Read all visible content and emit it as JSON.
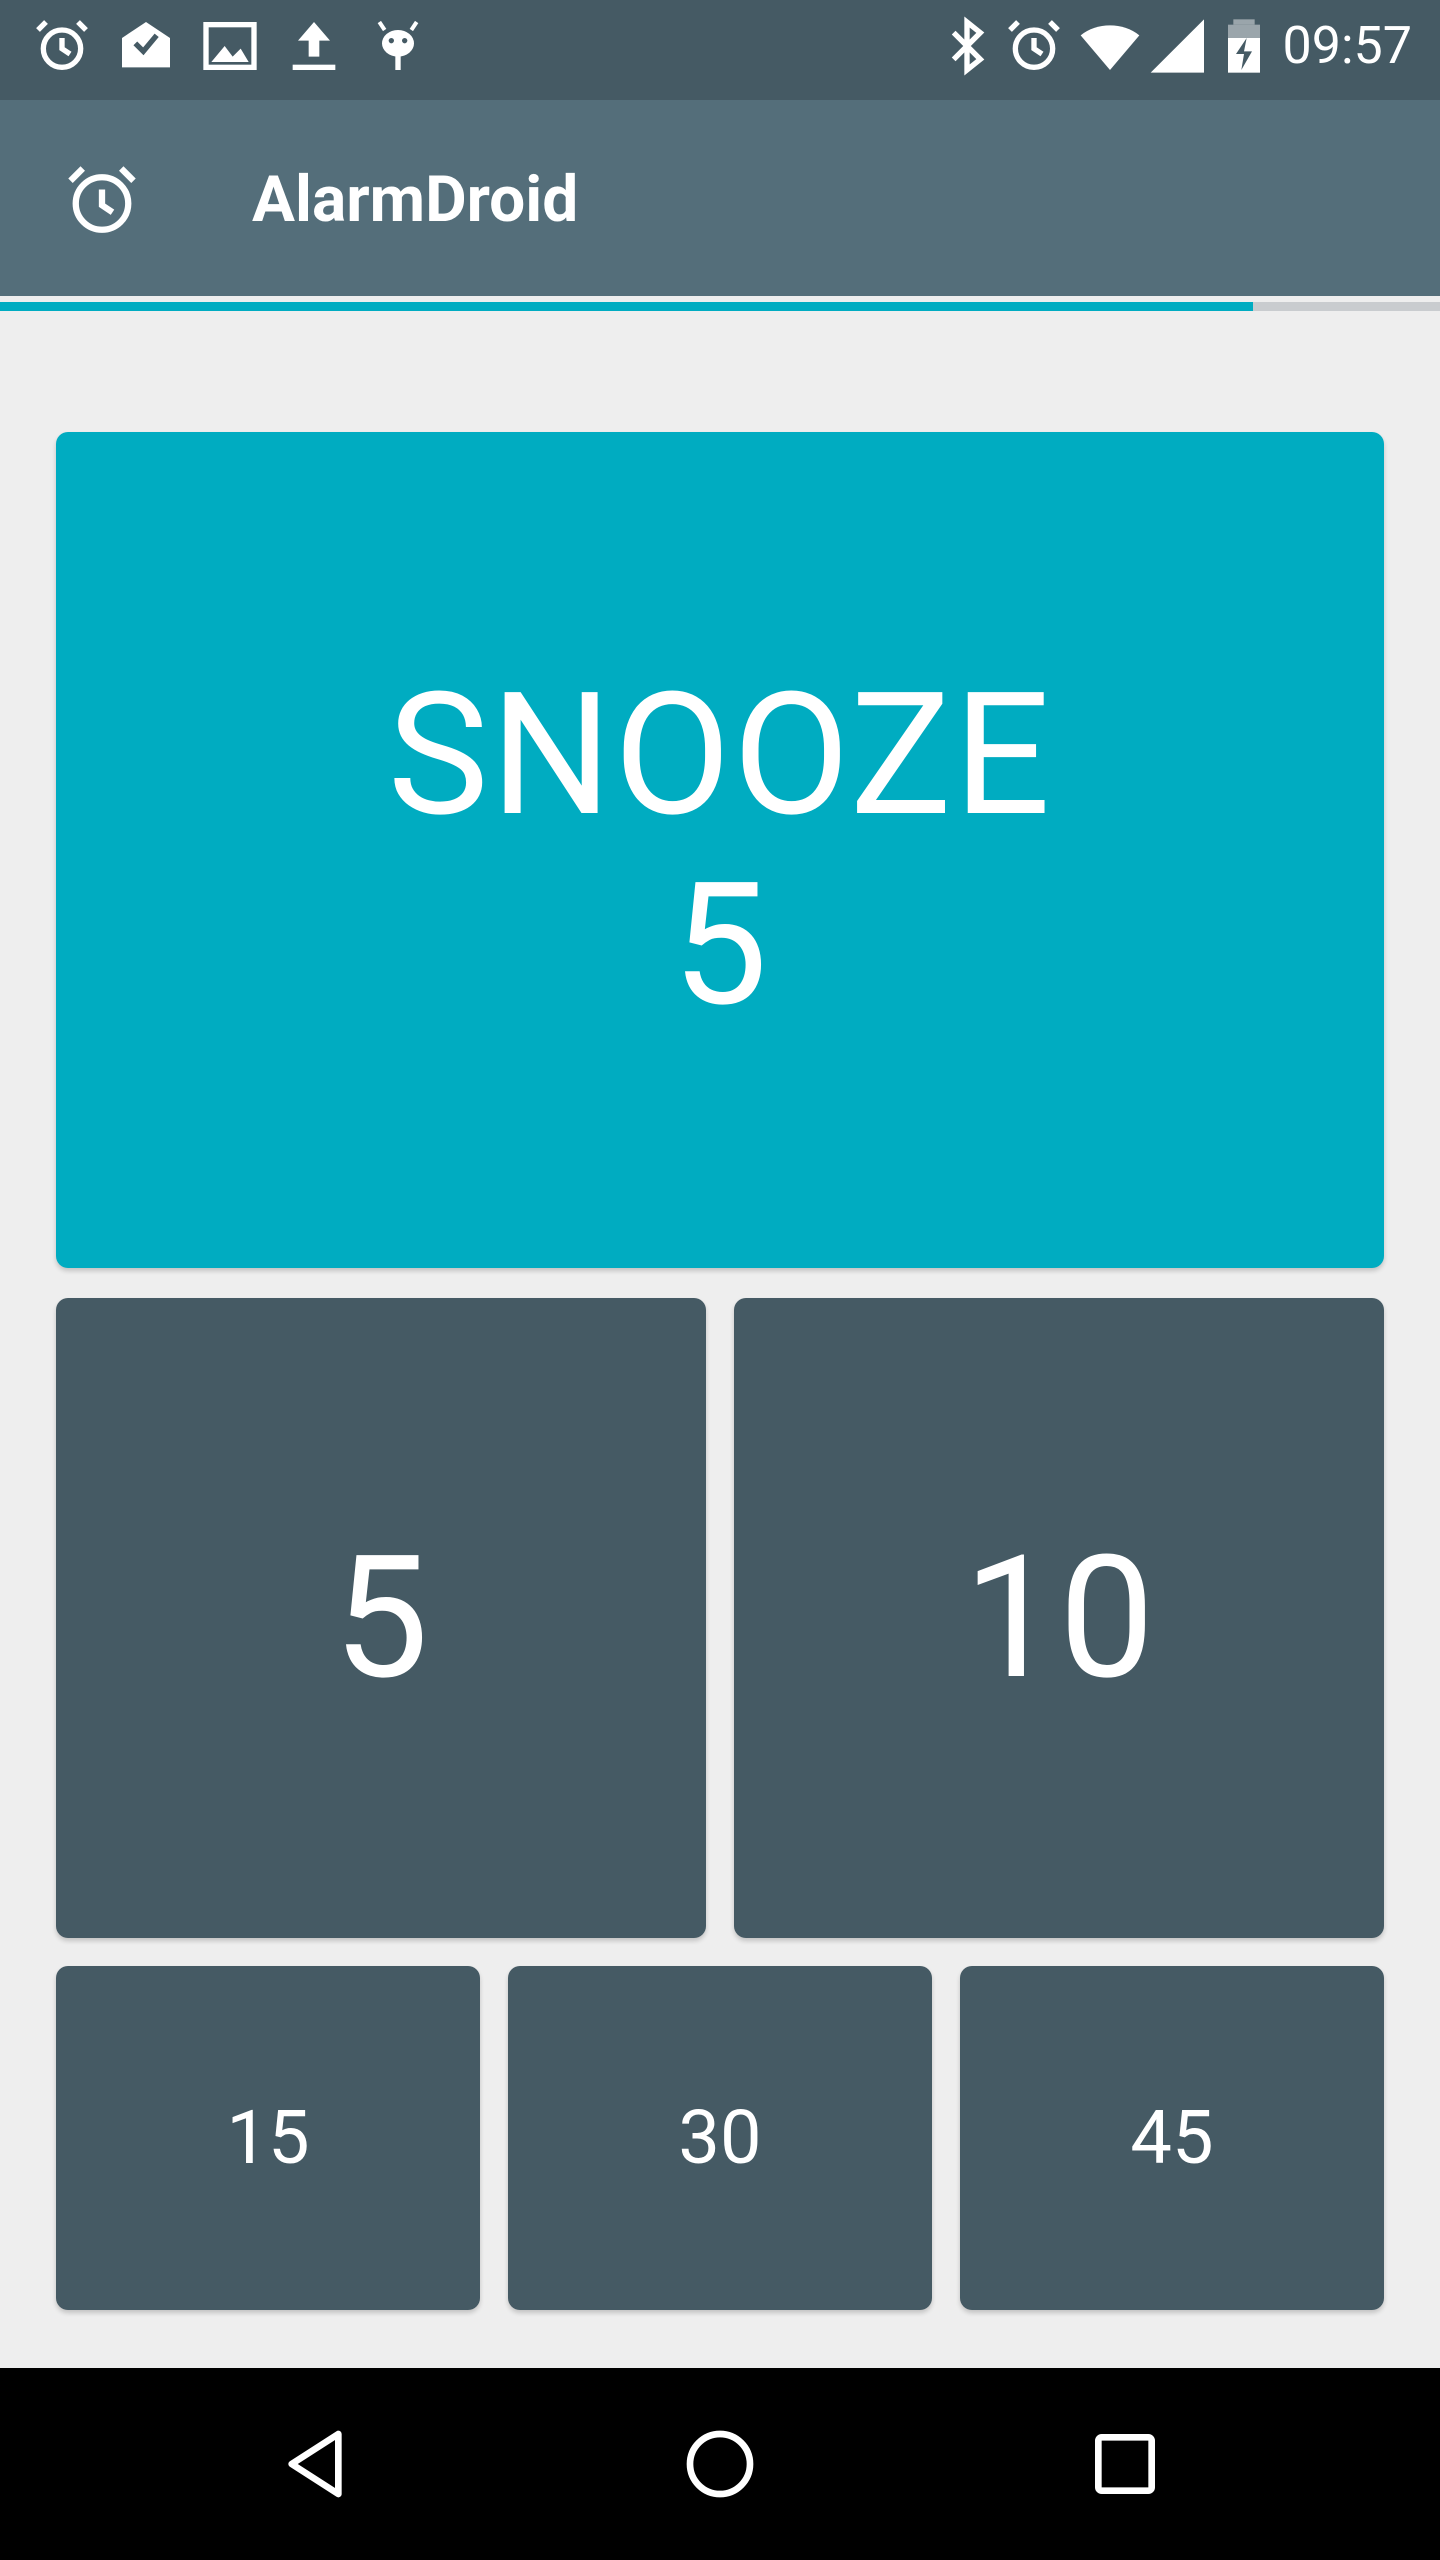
{
  "status_bar": {
    "left_icons": [
      "alarm-clock-icon",
      "mail-done-icon",
      "image-icon",
      "upload-icon",
      "android-debug-icon"
    ],
    "right_icons": [
      "bluetooth-icon",
      "alarm-clock-icon",
      "wifi-icon",
      "cell-signal-icon",
      "battery-charging-icon"
    ],
    "time": "09:57"
  },
  "app_bar": {
    "icon": "alarm-clock-icon",
    "title": "AlarmDroid"
  },
  "progress": {
    "fraction": 0.87,
    "color": "#00acc1"
  },
  "snooze": {
    "label": "SNOOZE",
    "value": "5"
  },
  "options": {
    "large": [
      "5",
      "10"
    ],
    "small": [
      "15",
      "30",
      "45"
    ]
  },
  "nav_bar": {
    "buttons": [
      "back-icon",
      "home-icon",
      "recents-icon"
    ]
  },
  "colors": {
    "status_bar": "#455a64",
    "app_bar": "#546e7a",
    "accent": "#00acc1",
    "tile": "#455a64",
    "background": "#eeeeee"
  }
}
